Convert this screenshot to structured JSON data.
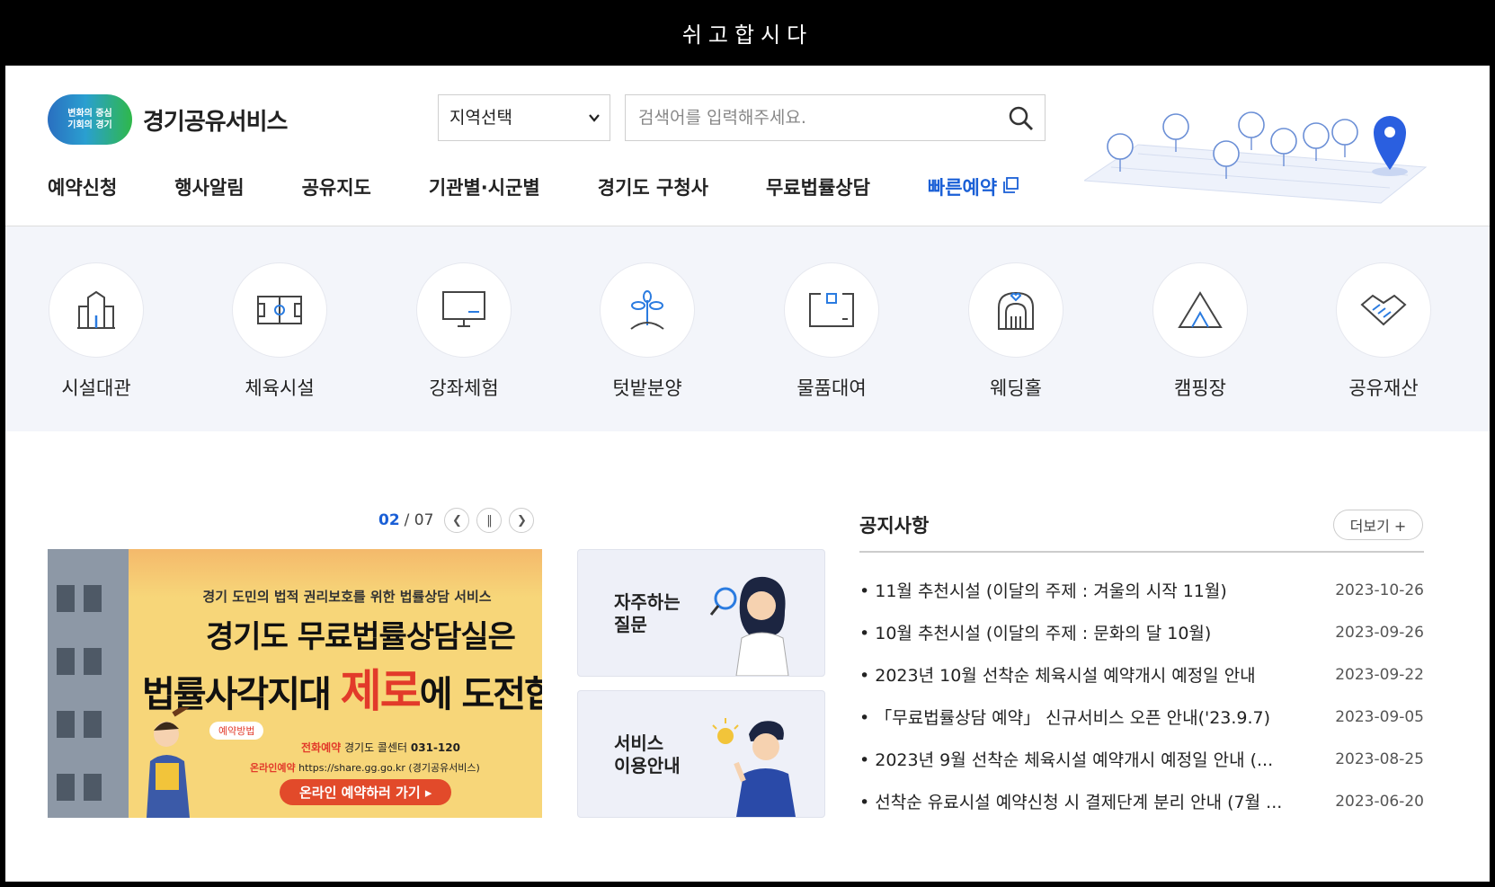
{
  "window_title": "쉬고합시다",
  "logo": {
    "badge_line1": "변화의 중심",
    "badge_line2": "기회의 경기",
    "name": "경기공유서비스"
  },
  "search": {
    "region_label": "지역선택",
    "placeholder": "검색어를 입력해주세요."
  },
  "gnb": [
    {
      "label": "예약신청"
    },
    {
      "label": "행사알림"
    },
    {
      "label": "공유지도"
    },
    {
      "label": "기관별·시군별"
    },
    {
      "label": "경기도 구청사"
    },
    {
      "label": "무료법률상담"
    },
    {
      "label": "빠른예약"
    }
  ],
  "categories": [
    {
      "label": "시설대관",
      "icon": "building-icon"
    },
    {
      "label": "체육시설",
      "icon": "field-icon"
    },
    {
      "label": "강좌체험",
      "icon": "monitor-icon"
    },
    {
      "label": "텃밭분양",
      "icon": "sprout-icon"
    },
    {
      "label": "물품대여",
      "icon": "box-icon"
    },
    {
      "label": "웨딩홀",
      "icon": "wedding-icon"
    },
    {
      "label": "캠핑장",
      "icon": "tent-icon"
    },
    {
      "label": "공유재산",
      "icon": "handshake-icon"
    }
  ],
  "banner": {
    "current": "02",
    "total": "/ 07",
    "line1": "경기 도민의 법적 권리보호를 위한 법률상담 서비스",
    "headline1": "경기도 무료법률상담실은",
    "headline2_a": "법률사각지대 ",
    "headline2_b": "제로",
    "headline2_c": "에 도전합",
    "tag": "예약방법",
    "phone_label": "전화예약",
    "phone_text": "경기도 콜센터",
    "phone_number": "031-120",
    "online_label": "온라인예약",
    "online_url": "https://share.gg.go.kr",
    "online_note": "(경기공유서비스)",
    "cta": "온라인 예약하러 가기 ▸"
  },
  "quick": [
    {
      "line1": "자주하는",
      "line2": "질문"
    },
    {
      "line1": "서비스",
      "line2": "이용안내"
    }
  ],
  "notices": {
    "title": "공지사항",
    "more": "더보기 +",
    "items": [
      {
        "text": "11월 추천시설 (이달의 주제 : 겨울의 시작 11월)",
        "date": "2023-10-26"
      },
      {
        "text": "10월 추천시설 (이달의 주제 : 문화의 달 10월)",
        "date": "2023-09-26"
      },
      {
        "text": "2023년 10월 선착순 체육시설 예약개시 예정일 안내",
        "date": "2023-09-22"
      },
      {
        "text": "「무료법률상담 예약」 신규서비스 오픈 안내('23.9.7)",
        "date": "2023-09-05"
      },
      {
        "text": "2023년 9월 선착순 체육시설 예약개시 예정일 안내 (...",
        "date": "2023-08-25"
      },
      {
        "text": "선착순 유료시설 예약신청 시 결제단계 분리 안내 (7월 ...",
        "date": "2023-06-20"
      }
    ]
  },
  "colors": {
    "accent": "#1a5fd6",
    "band": "#f3f5fa",
    "banner": "#f7d679",
    "highlight_red": "#e23a2a"
  }
}
